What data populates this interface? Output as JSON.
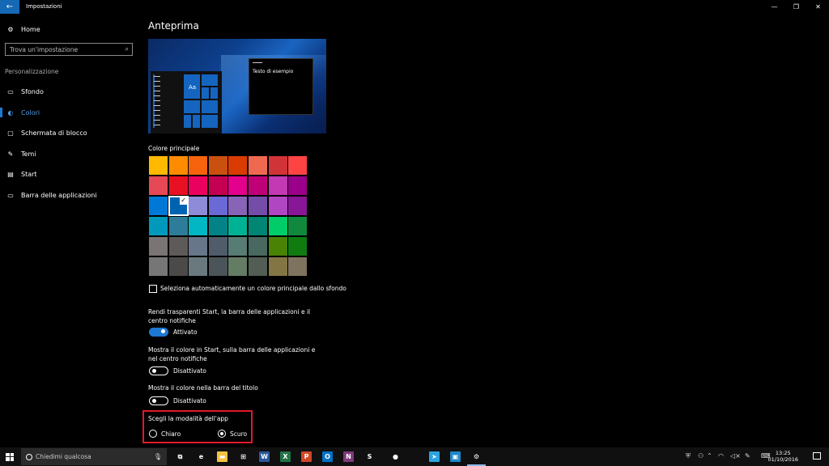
{
  "window": {
    "title": "Impostazioni",
    "back_icon": "←",
    "controls": [
      "—",
      "❐",
      "✕"
    ]
  },
  "sidebar": {
    "home": "Home",
    "search_placeholder": "Trova un'impostazione",
    "section": "Personalizzazione",
    "items": [
      {
        "label": "Sfondo",
        "icon": "image-icon"
      },
      {
        "label": "Colori",
        "icon": "palette-icon",
        "active": true
      },
      {
        "label": "Schermata di blocco",
        "icon": "lock-screen-icon"
      },
      {
        "label": "Temi",
        "icon": "brush-icon"
      },
      {
        "label": "Start",
        "icon": "start-icon"
      },
      {
        "label": "Barra delle applicazioni",
        "icon": "taskbar-icon"
      }
    ],
    "accent": "#1e78d2"
  },
  "main": {
    "heading": "Anteprima",
    "preview": {
      "tile_text": "Aa",
      "sample_text": "Testo di esempio"
    },
    "accent_label": "Colore principale",
    "palette": [
      [
        "#ffb900",
        "#ff8c00",
        "#f7630c",
        "#ca5010",
        "#da3b01",
        "#ef6950",
        "#d13438",
        "#ff4343"
      ],
      [
        "#e74856",
        "#e81123",
        "#ea005e",
        "#c30052",
        "#e3008c",
        "#bf0077",
        "#c239b3",
        "#9a0089"
      ],
      [
        "#0078d7",
        "#0063b1",
        "#8e8cd8",
        "#6b69d6",
        "#8764b8",
        "#744da9",
        "#b146c2",
        "#881798"
      ],
      [
        "#0099bc",
        "#2d7d9a",
        "#00b7c3",
        "#038387",
        "#00b294",
        "#018574",
        "#00cc6a",
        "#10893e"
      ],
      [
        "#7a7574",
        "#5d5a58",
        "#68768a",
        "#515c6b",
        "#567c73",
        "#486860",
        "#498205",
        "#107c10"
      ],
      [
        "#767676",
        "#4c4a48",
        "#69797e",
        "#4a5459",
        "#647c64",
        "#525e54",
        "#847545",
        "#7e735f"
      ]
    ],
    "selected_swatch": {
      "row": 2,
      "col": 1
    },
    "auto_accent_label": "Seleziona automaticamente un colore principale dallo sfondo",
    "auto_accent_checked": false,
    "transparency": {
      "label": "Rendi trasparenti Start, la barra delle applicazioni e il centro notifiche",
      "state": "Attivato",
      "on": true
    },
    "color_on_start": {
      "label": "Mostra il colore in Start, sulla barra delle applicazioni e nel centro notifiche",
      "state": "Disattivato",
      "on": false
    },
    "color_on_title": {
      "label": "Mostra il colore nella barra del titolo",
      "state": "Disattivato",
      "on": false
    },
    "app_mode": {
      "label": "Scegli la modalità dell'app",
      "options": [
        "Chiaro",
        "Scuro"
      ],
      "selected": "Scuro"
    },
    "highlight_color": "#e01a2a"
  },
  "taskbar": {
    "search_placeholder": "Chiedimi qualcosa",
    "apps": [
      {
        "name": "task-view",
        "glyph": "⧉",
        "color": "transparent"
      },
      {
        "name": "edge",
        "glyph": "e",
        "color": "transparent"
      },
      {
        "name": "file-explorer",
        "glyph": "▬",
        "color": "#f4c242"
      },
      {
        "name": "store",
        "glyph": "⊞",
        "color": "transparent"
      },
      {
        "name": "word",
        "glyph": "W",
        "color": "#2b579a"
      },
      {
        "name": "excel",
        "glyph": "X",
        "color": "#217346"
      },
      {
        "name": "powerpoint",
        "glyph": "P",
        "color": "#d24726"
      },
      {
        "name": "outlook",
        "glyph": "O",
        "color": "#0072c6"
      },
      {
        "name": "onenote",
        "glyph": "N",
        "color": "#80397b"
      },
      {
        "name": "skype",
        "glyph": "S",
        "color": "transparent"
      },
      {
        "name": "app",
        "glyph": "●",
        "color": "transparent"
      },
      {
        "name": "telegram",
        "glyph": "➤",
        "color": "#2ca5e0"
      },
      {
        "name": "image-app",
        "glyph": "▣",
        "color": "#1e88c8"
      },
      {
        "name": "settings",
        "glyph": "⚙",
        "color": "transparent",
        "active": true
      }
    ],
    "time": "13:25",
    "date": "01/10/2016"
  }
}
